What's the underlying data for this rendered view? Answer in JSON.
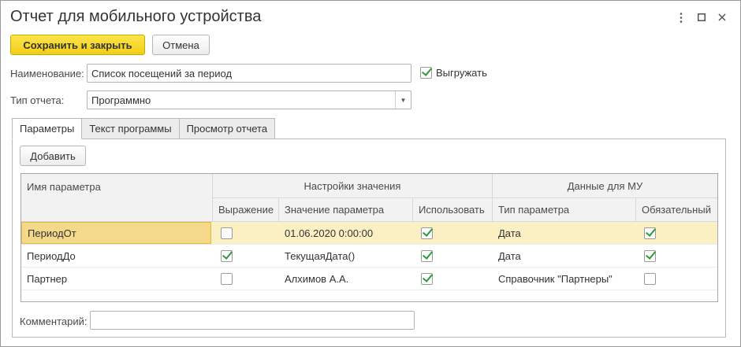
{
  "window": {
    "title": "Отчет для мобильного устройства",
    "menu_icon": "more-vertical-icon",
    "maximize_icon": "maximize-icon",
    "close_icon": "close-icon"
  },
  "toolbar": {
    "save_close_label": "Сохранить и закрыть",
    "cancel_label": "Отмена"
  },
  "form": {
    "name_label": "Наименование:",
    "name_value": "Список посещений за период",
    "export_label": "Выгружать",
    "export_checked": true,
    "report_type_label": "Тип отчета:",
    "report_type_value": "Программно"
  },
  "tabs": [
    {
      "label": "Параметры",
      "active": true
    },
    {
      "label": "Текст программы",
      "active": false
    },
    {
      "label": "Просмотр отчета",
      "active": false
    }
  ],
  "params": {
    "add_label": "Добавить",
    "header": {
      "name": "Имя параметра",
      "group_value": "Настройки значения",
      "group_mu": "Данные для МУ",
      "expression": "Выражение",
      "value": "Значение параметра",
      "use": "Использовать",
      "type": "Тип параметра",
      "required": "Обязательный"
    },
    "rows": [
      {
        "name": "ПериодОт",
        "expression": false,
        "value": "01.06.2020 0:00:00",
        "use": true,
        "type": "Дата",
        "required": true
      },
      {
        "name": "ПериодДо",
        "expression": true,
        "value": "ТекущаяДата()",
        "use": true,
        "type": "Дата",
        "required": true
      },
      {
        "name": "Партнер",
        "expression": false,
        "value": "Алхимов А.А.",
        "use": true,
        "type": "Справочник \"Партнеры\"",
        "required": false
      }
    ]
  },
  "comment": {
    "label": "Комментарий:",
    "value": ""
  },
  "colors": {
    "accent": "#f2cd17",
    "selected_row": "#fbf0c4",
    "check": "#2e9a3c"
  }
}
